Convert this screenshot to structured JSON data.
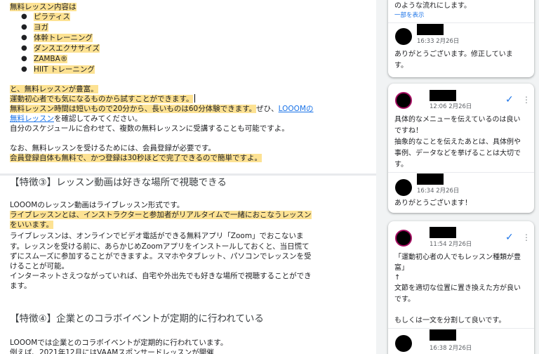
{
  "doc": {
    "lines1": [
      "無料レッスン内容は"
    ],
    "bullets": [
      "ピラティス",
      "ヨガ",
      "体幹トレーニング",
      "ダンスエクササイズ",
      "ZAMBA®",
      "HIIT トレーニング"
    ],
    "p1": "と、無料レッスンが豊富。",
    "p2": "運動初心者でも気になるものから試すことができます。",
    "p3a": "無料レッスン時間は短いもので20分から、長いものは60分体験できます。",
    "p3b": "ぜひ、",
    "p3link1": "LOOOMの",
    "p4link2": "無料レッスン",
    "p4b": "を確認してみてください。",
    "p5": "自分のスケジュールに合わせて、複数の無料レッスンに受講することも可能ですよ。",
    "p6": "なお、無料レッスンを受けるためには、会員登録が必要です。",
    "p7": "会員登録自体も無料で、かつ登録は30秒ほどで完了できるので簡単ですよ。",
    "heading3": "【特徴③】レッスン動画は好きな場所で視聴できる",
    "s1": "LOOOMのレッスン動画はライブレッスン形式です。",
    "s2": "ライブレッスンとは、インストラクターと参加者がリアルタイムで一緒におこなうレッスン",
    "s3": "をいいます。",
    "s4": "ライブレッスンは、オンラインでビデオ電話ができる無料アプリ「Zoom」でおこないま",
    "s5": "す。レッスンを受ける前に、あらかじめZoomアプリをインストールしておくと、当日慌て",
    "s6": "ずにスムーズに参加することができますよ。スマホやタブレット、パソコンでレッスンを受",
    "s7": "けることが可能。",
    "s8": "インターネットさえつながっていれば、自宅や外出先でも好きな場所で視聴することができ",
    "s9": "ます。",
    "heading4": "【特徴④】企業とのコラボイベントが定期的に行われている",
    "t1": "LOOOMでは企業とのコラボイベントが定期的に行われています。",
    "t2": "例えば、2021年12月にはVAAMスポンサードレッスンが開催"
  },
  "comments": {
    "card1": {
      "top_text": "のような流れにします。",
      "show_more": "一部を表示",
      "reply_time": "16:33 2月26日",
      "reply_text": [
        "ありがとうございます。修正していま",
        "す。"
      ]
    },
    "card2": {
      "time": "12:06 2月26日",
      "text": [
        "具体的なメニューを伝えているのは良い",
        "ですね！",
        "抽象的なことを伝えたあとは、具体例や",
        "事例、データなどを挙げることは大切で",
        "す。"
      ],
      "reply_time": "16:34 2月26日",
      "reply_text": "ありがとうございます！"
    },
    "card3": {
      "time": "11:54 2月26日",
      "text": [
        "「運動初心者の人でもレッスン種類が豊",
        "富」",
        "↑",
        "文節を適切な位置に置き換えた方が良い",
        "です。",
        "",
        "もしくは一文を分割して良いです。"
      ],
      "reply_time": "16:38 2月26日"
    },
    "icons": {
      "check": "✓",
      "more": "⋮"
    },
    "colors": {
      "highlight": "#fde293",
      "link": "#1a73e8",
      "avatar_ring": "#a50e62"
    }
  }
}
